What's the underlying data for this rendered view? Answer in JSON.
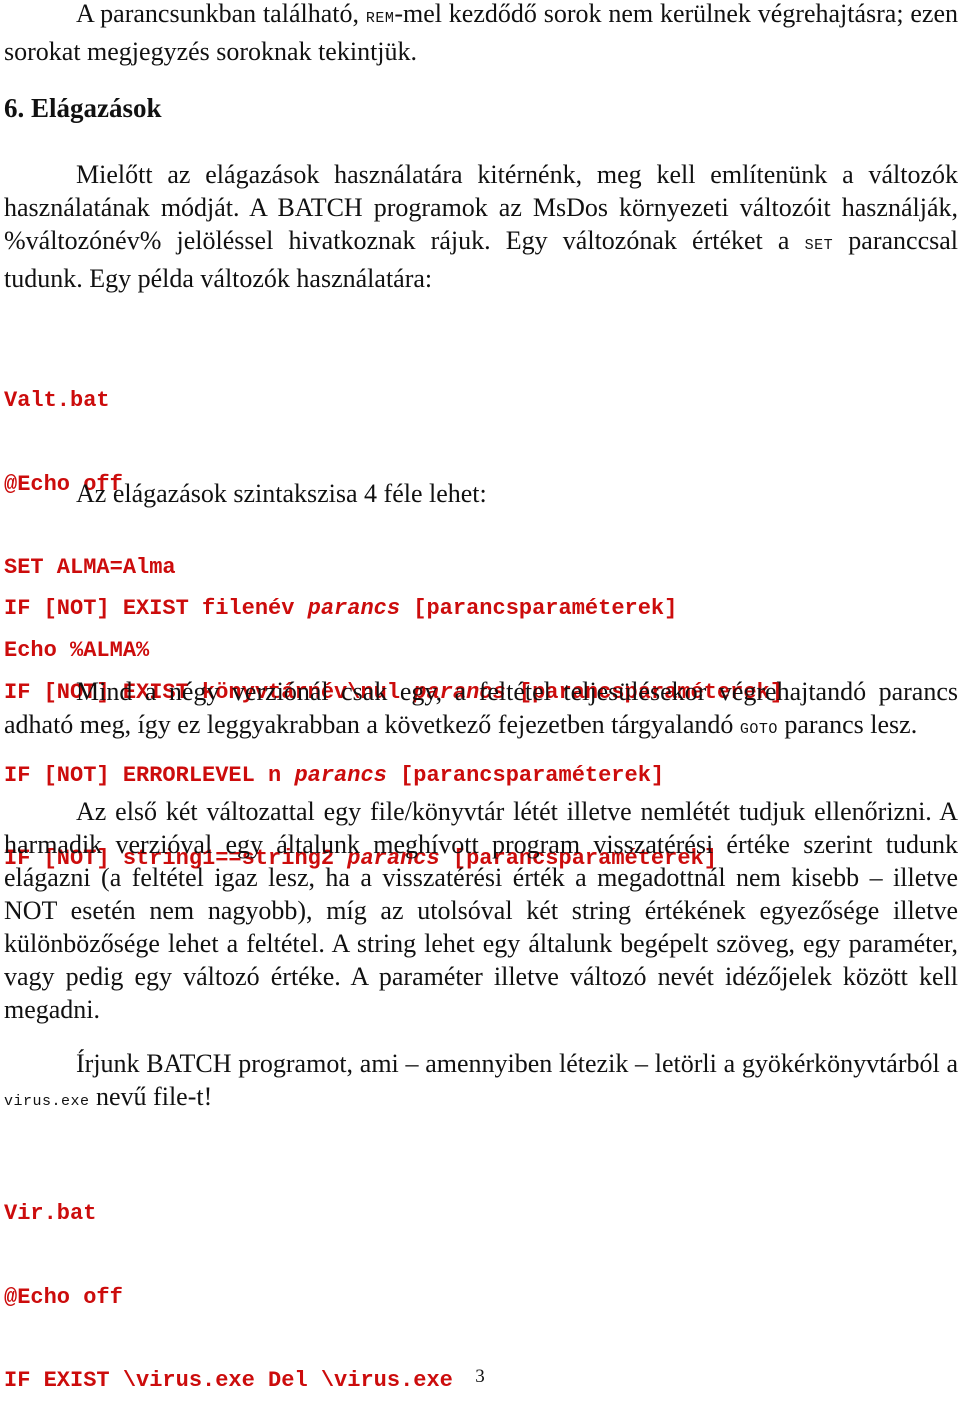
{
  "intro": {
    "part1": "A parancsunkban található, ",
    "rem": "REM",
    "part2": "-mel kezdődő sorok nem kerülnek végrehajtásra; ezen sorokat megjegyzés soroknak tekintjük."
  },
  "section": {
    "heading": "6. Elágazások"
  },
  "para_variables": {
    "part1": "Mielőtt az elágazások használatára kitérnénk, meg kell említenünk a változók használatának módját. A BATCH programok az MsDos környezeti változóit használják, %változónév% jelöléssel hivatkoznak rájuk. Egy változónak értéket a ",
    "set": "SET",
    "part2": " paranccsal tudunk. Egy példa változók használatára:"
  },
  "example1": {
    "lines": [
      "Valt.bat",
      "@Echo off",
      "SET ALMA=Alma",
      "Echo %ALMA%"
    ]
  },
  "syntax_intro": "Az elágazások szintakszisa 4 féle lehet:",
  "syntax": [
    {
      "prefix": "IF [NOT] EXIST filenév ",
      "cmd": "parancs",
      "suffix": " [parancsparaméterek]"
    },
    {
      "prefix": "IF [NOT] EXIST könyvtárnév\\nul ",
      "cmd": "parancs",
      "suffix": " [parancsparaméterek]"
    },
    {
      "prefix": "IF [NOT] ERRORLEVEL n ",
      "cmd": "parancs",
      "suffix": " [parancsparaméterek]"
    },
    {
      "prefix": "IF [NOT] string1==string2 ",
      "cmd": "parancs",
      "suffix": " [parancsparaméterek]"
    }
  ],
  "para_versions": {
    "part1": "Mind a négy verziónál csak egy, a feltétel teljesülésekor végrehajtandó parancs adható meg, így ez leggyakrabban a következő fejezetben tárgyalandó ",
    "goto": "GOTO",
    "part2": " parancs lesz."
  },
  "para_explain": "Az első két változattal egy file/könyvtár létét illetve nemlétét tudjuk ellenőrizni. A harmadik verzióval egy általunk meghívott program visszatérési értéke szerint tudunk elágazni (a feltétel igaz lesz, ha a visszatérési érték a megadottnál nem kisebb – illetve NOT esetén nem nagyobb), míg az utolsóval két string értékének egyezősége illetve különbözősége lehet a feltétel. A string lehet egy általunk begépelt szöveg, egy paraméter, vagy pedig egy változó értéke. A paraméter illetve változó nevét  idézőjelek között kell megadni.",
  "para_task": {
    "part1": "Írjunk BATCH programot, ami – amennyiben létezik – letörli a gyökérkönyvtárból a ",
    "file": "virus.exe",
    "part2": " nevű file-t!"
  },
  "example2": {
    "lines": [
      "Vir.bat",
      "@Echo off",
      "IF EXIST \\virus.exe Del \\virus.exe"
    ]
  },
  "page_number": "3",
  "colors": {
    "code": "#cc0c0c",
    "text": "#111111"
  }
}
